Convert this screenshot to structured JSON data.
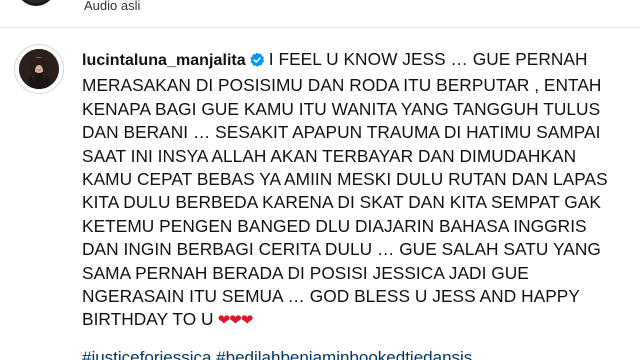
{
  "previous_post": {
    "audio_label": "Audio asli"
  },
  "caption": {
    "username": "lucintaluna_manjalita",
    "verified": true,
    "text": "I FEEL U KNOW JESS … GUE PERNAH MERASAKAN DI POSISIMU DAN RODA ITU BERPUTAR , ENTAH KENAPA BAGI GUE KAMU ITU WANITA YANG TANGGUH TULUS DAN BERANI … SESAKIT APAPUN TRAUMA DI HATIMU SAMPAI SAAT INI INSYA ALLAH AKAN TERBAYAR DAN DIMUDAHKAN KAMU CEPAT BEBAS YA AMIIN MESKI DULU RUTAN DAN LAPAS KITA DULU BERBEDA KARENA DI SKAT DAN KITA SEMPAT GAK KETEMU PENGEN BANGED DLU DIAJARIN BAHASA INGGRIS DAN INGIN BERBAGI CERITA DULU … GUE SALAH SATU YANG SAMA PERNAH BERADA DI POSISI JESSICA JADI GUE NGERASAIN ITU SEMUA … GOD BLESS U JESS AND HAPPY BIRTHDAY TO U",
    "emoji": "❤❤❤",
    "hashtags": "#justiceforjessica #bedilahbenjaminbookedtiedansis"
  },
  "colors": {
    "verified_badge": "#0095f6",
    "hashtag_link": "#00376b",
    "heart": "#e0142a"
  },
  "icons": {
    "verified": "verified-badge-icon"
  }
}
